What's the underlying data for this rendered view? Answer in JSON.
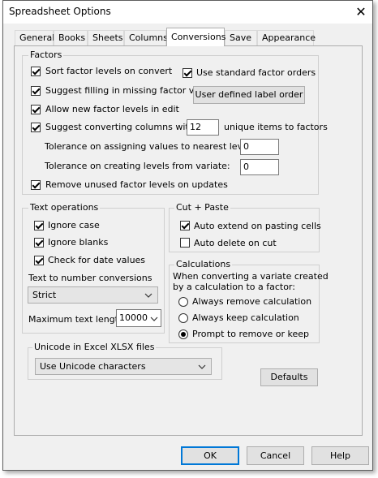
{
  "window": {
    "title": "Spreadsheet Options",
    "close_glyph": "✕"
  },
  "tabs": [
    "General",
    "Books",
    "Sheets",
    "Columns",
    "Conversions",
    "Save",
    "Appearance"
  ],
  "selected_tab": "Conversions",
  "factors": {
    "title": "Factors",
    "sort_levels": {
      "label": "Sort factor levels on convert",
      "checked": true
    },
    "standard_orders": {
      "label": "Use standard factor orders",
      "checked": true
    },
    "suggest_filling": {
      "label": "Suggest filling in missing factor values",
      "checked": true
    },
    "user_defined_button": "User defined label order",
    "allow_new_levels": {
      "label": "Allow new factor levels in edit",
      "checked": true
    },
    "suggest_converting": {
      "label": "Suggest converting columns with <=",
      "checked": true,
      "value": "12",
      "suffix": "unique items to factors"
    },
    "tolerance_assign": {
      "label": "Tolerance on assigning values to nearest level:",
      "value": "0"
    },
    "tolerance_create": {
      "label": "Tolerance on creating levels from variate:",
      "value": "0"
    },
    "remove_unused": {
      "label": "Remove unused factor levels on updates",
      "checked": true
    }
  },
  "text_ops": {
    "title": "Text operations",
    "ignore_case": {
      "label": "Ignore case",
      "checked": true
    },
    "ignore_blanks": {
      "label": "Ignore blanks",
      "checked": true
    },
    "check_dates": {
      "label": "Check for date values",
      "checked": true
    },
    "conv_label": "Text to number conversions",
    "conv_value": "Strict",
    "max_len_label": "Maximum text length:",
    "max_len_value": "10000"
  },
  "cut_paste": {
    "title": "Cut + Paste",
    "auto_extend": {
      "label": "Auto extend on pasting cells",
      "checked": true
    },
    "auto_delete": {
      "label": "Auto delete on cut",
      "checked": false
    }
  },
  "calculations": {
    "title": "Calculations",
    "desc_line1": "When converting a variate created",
    "desc_line2": "by a calculation to a factor:",
    "options": [
      "Always remove calculation",
      "Always keep calculation",
      "Prompt to remove or keep"
    ],
    "selected_index": 2
  },
  "unicode": {
    "title": "Unicode in Excel XLSX files",
    "value": "Use Unicode characters"
  },
  "defaults_button": "Defaults",
  "footer": {
    "ok": "OK",
    "cancel": "Cancel",
    "help": "Help"
  },
  "colors": {
    "dialog_bg": "#f0f0f0",
    "default_button_border": "#0078d7"
  }
}
